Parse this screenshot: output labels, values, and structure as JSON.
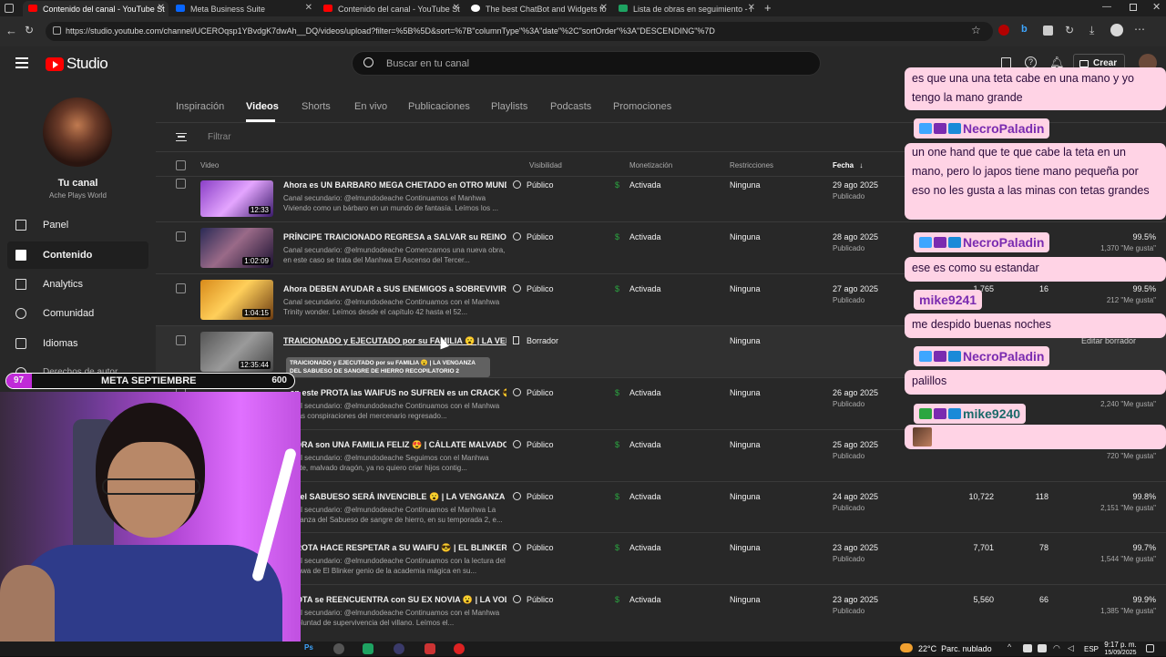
{
  "browser": {
    "tabs": [
      {
        "label": "Contenido del canal - YouTube St",
        "active": true,
        "color": "#ff0000"
      },
      {
        "label": "Meta Business Suite",
        "active": false,
        "color": "#0866ff"
      },
      {
        "label": "Contenido del canal - YouTube St",
        "active": false,
        "color": "#ff0000"
      },
      {
        "label": "The best ChatBot and Widgets fo",
        "active": false,
        "color": "#ffffff"
      },
      {
        "label": "Lista de obras en seguimiento - I",
        "active": false,
        "color": "#1ea362"
      }
    ],
    "url": "https://studio.youtube.com/channel/UCEROqsp1YBvdgK7dwAh__DQ/videos/upload?filter=%5B%5D&sort=%7B\"columnType\"%3A\"date\"%2C\"sortOrder\"%3A\"DESCENDING\"%7D"
  },
  "header": {
    "logo": "Studio",
    "search_placeholder": "Buscar en tu canal",
    "create_label": "Crear"
  },
  "sidebar": {
    "channel_label": "Tu canal",
    "channel_name": "Ache Plays World",
    "items": [
      {
        "label": "Panel",
        "icon": "dashboard-icon"
      },
      {
        "label": "Contenido",
        "icon": "content-icon",
        "selected": true
      },
      {
        "label": "Analytics",
        "icon": "analytics-icon"
      },
      {
        "label": "Comunidad",
        "icon": "community-icon"
      },
      {
        "label": "Idiomas",
        "icon": "languages-icon"
      },
      {
        "label": "Derechos de autor",
        "icon": "copyright-icon"
      }
    ]
  },
  "content_tabs": [
    "Inspiración",
    "Videos",
    "Shorts",
    "En vivo",
    "Publicaciones",
    "Playlists",
    "Podcasts",
    "Promociones"
  ],
  "filter_label": "Filtrar",
  "columns": {
    "video": "Video",
    "visibility": "Visibilidad",
    "monetization": "Monetización",
    "restrictions": "Restricciones",
    "date": "Fecha"
  },
  "rows": [
    {
      "title": "Ahora es UN BARBARO MEGA CHETADO en OTRO MUNDO ...",
      "desc": "Canal secundario: @elmundodeache Continuamos el Manhwa Viviendo como un bárbaro en un mundo de fantasía. Leímos los ...",
      "duration": "12:33",
      "visibility": "Público",
      "monetization": "Activada",
      "restrictions": "Ninguna",
      "date": "29 ago 2025",
      "status": "Publicado",
      "views": "",
      "comments": "",
      "pct": "",
      "likes": ""
    },
    {
      "title": "PRÍNCIPE TRAICIONADO REGRESA a SALVAR su REINO 😮 | ...",
      "desc": "Canal secundario: @elmundodeache Comenzamos una nueva obra, en este caso se trata del Manhwa El Ascenso del Tercer...",
      "duration": "1:02:09",
      "visibility": "Público",
      "monetization": "Activada",
      "restrictions": "Ninguna",
      "date": "28 ago 2025",
      "status": "Publicado",
      "views": "",
      "comments": "",
      "pct": "99.5%",
      "likes": "1,370 \"Me gusta\""
    },
    {
      "title": "Ahora DEBEN AYUDAR a SUS ENEMIGOS a SOBREVIVIR 😮 | ...",
      "desc": "Canal secundario: @elmundodeache Continuamos con el Manhwa Trinity wonder. Leímos desde el capítulo 42 hasta el 52...",
      "duration": "1:04:15",
      "visibility": "Público",
      "monetization": "Activada",
      "restrictions": "Ninguna",
      "date": "27 ago 2025",
      "status": "Publicado",
      "views": "1,765",
      "comments": "16",
      "pct": "99.5%",
      "likes": "212 \"Me gusta\""
    },
    {
      "title": "TRAICIONADO y EJECUTADO por su FAMILIA 😮 | LA VENGA...",
      "desc": "",
      "duration": "12:35:44",
      "visibility": "Borrador",
      "monetization": "",
      "restrictions": "Ninguna",
      "date": "",
      "status": "",
      "views": "",
      "comments": "",
      "pct": "",
      "likes": "",
      "tooltip": "TRAICIONADO y EJECUTADO por su FAMILIA 😮 | LA VENGANZA DEL SABUESO DE SANGRE DE HIERRO RECOPILATORIO 2",
      "action": "Editar borrador"
    },
    {
      "title": "...en este PROTA las WAIFUS no SUFREN es un CRACK 😎 | L...",
      "desc": "Canal secundario: @elmundodeache Continuamos con el Manhwa de Las conspiraciones del mercenario regresado...",
      "duration": "",
      "visibility": "Público",
      "monetization": "Activada",
      "restrictions": "Ninguna",
      "date": "26 ago 2025",
      "status": "Publicado",
      "views": "",
      "comments": "",
      "pct": "",
      "likes": "2,240 \"Me gusta\""
    },
    {
      "title": "AHORA son UNA FAMILIA FELIZ 😍 | CÁLLATE MALVADO DR...",
      "desc": "Canal secundario: @elmundodeache Seguimos con el Manhwa Cállate, malvado dragón, ya no quiero criar hijos contig...",
      "duration": "",
      "visibility": "Público",
      "monetization": "Activada",
      "restrictions": "Ninguna",
      "date": "25 ago 2025",
      "status": "Publicado",
      "views": "",
      "comments": "",
      "pct": "",
      "likes": "720 \"Me gusta\""
    },
    {
      "title": "...ra el SABUESO SERÁ INVENCIBLE 😮 | LA VENGANZA D...",
      "desc": "Canal secundario: @elmundodeache Continuamos el Manhwa La Venganza del Sabueso de sangre de hierro, en su temporada 2, e...",
      "duration": "",
      "visibility": "Público",
      "monetization": "Activada",
      "restrictions": "Ninguna",
      "date": "24 ago 2025",
      "status": "Publicado",
      "views": "10,722",
      "comments": "118",
      "pct": "99.8%",
      "likes": "2,151 \"Me gusta\""
    },
    {
      "title": "...PROTA HACE RESPETAR a SU WAIFU 😎 | EL BLINKER ...",
      "desc": "Canal secundario: @elmundodeache Continuamos con la lectura del Manhwa de El Blinker genio de la academia mágica en su...",
      "duration": "",
      "visibility": "Público",
      "monetization": "Activada",
      "restrictions": "Ninguna",
      "date": "23 ago 2025",
      "status": "Publicado",
      "views": "7,701",
      "comments": "78",
      "pct": "99.7%",
      "likes": "1,544 \"Me gusta\""
    },
    {
      "title": "...ROTA se REENCUENTRA con SU EX NOVIA 😮 | LA VOLU...",
      "desc": "Canal secundario: @elmundodeache Continuamos con el Manhwa La voluntad de supervivencia del villano. Leímos el...",
      "duration": "",
      "visibility": "Público",
      "monetization": "Activada",
      "restrictions": "Ninguna",
      "date": "23 ago 2025",
      "status": "Publicado",
      "views": "5,560",
      "comments": "66",
      "pct": "99.9%",
      "likes": "1,385 \"Me gusta\""
    }
  ],
  "goal": {
    "left": "97",
    "label": "META SEPTIEMBRE",
    "right": "600"
  },
  "chat": {
    "m1": "es que una una teta cabe en una mano y yo tengo la mano grande",
    "u2": "NecroPaladin",
    "m2": "un one hand que te que cabe la teta en un mano, pero lo japos tiene mano pequeña por eso no les gusta a las minas con tetas grandes",
    "u3": "NecroPaladin",
    "m3": "ese es como su estandar",
    "u4": "mike9241",
    "m4": "me despido buenas noches",
    "u5": "NecroPaladin",
    "m5": "palillos",
    "u6": "mike9240"
  },
  "taskbar": {
    "weather": "22°C  Parc. nublado",
    "lang": "ESP",
    "time": "9:17 p. m.",
    "date": "15/09/2025"
  },
  "colors": {
    "accent_pink": "#ffd3e5",
    "yt_red": "#ff0000",
    "money_green": "#2ba640"
  }
}
